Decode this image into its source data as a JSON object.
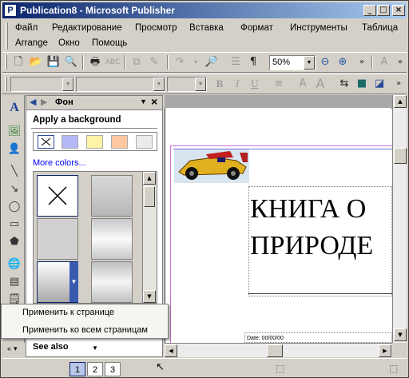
{
  "window": {
    "title": "Publication8 - Microsoft Publisher",
    "app_icon": "P",
    "buttons": {
      "minimize": "_",
      "maximize": "□",
      "close": "×"
    }
  },
  "menu": {
    "items": [
      "Файл",
      "Редактирование",
      "Просмотр",
      "Вставка",
      "Формат",
      "Инструменты",
      "Таблица",
      "Arrange",
      "Окно",
      "Помощь"
    ]
  },
  "toolbar_standard": {
    "zoom": "50%",
    "icons": [
      "new-icon",
      "open-icon",
      "save-icon",
      "search-icon",
      "print-icon",
      "spellcheck-icon",
      "copy-icon",
      "format-painter-icon",
      "redo-icon",
      "preview-icon",
      "list-icon",
      "pilcrow-icon",
      "zoom-out-icon",
      "zoom-in-icon",
      "more-icon"
    ]
  },
  "toolbar_format": {
    "style_combo": "",
    "font_combo": "",
    "size_combo": "",
    "icons": [
      "bold-icon",
      "italic-icon",
      "underline-icon",
      "align-icon",
      "font-color-icon",
      "grow-font-icon",
      "swap-icon",
      "fill-icon",
      "line-icon",
      "more-icon"
    ],
    "labels": {
      "bold": "B",
      "italic": "I",
      "underline": "U"
    }
  },
  "task_pane": {
    "title": "Фон",
    "section": "Apply a background",
    "more_colors": "More colors...",
    "see_also": "See also",
    "swatches": [
      "#ffffff",
      "#b3b8f5",
      "#fff3a8",
      "#ffc8a0",
      "#ebebeb"
    ]
  },
  "popup_menu": {
    "items": [
      "Применить к странице",
      "Применить ко всем страницам"
    ]
  },
  "document": {
    "heading_line1": "КНИГА О",
    "heading_line2": "ПРИРОДЕ",
    "date": "Date: 00/00/00"
  },
  "status": {
    "pages": [
      "1",
      "2",
      "3"
    ],
    "current_page": "1"
  },
  "colors": {
    "title_start": "#0a246a",
    "title_end": "#a6caf0",
    "face": "#d4d0c8",
    "link": "#0000ff"
  }
}
